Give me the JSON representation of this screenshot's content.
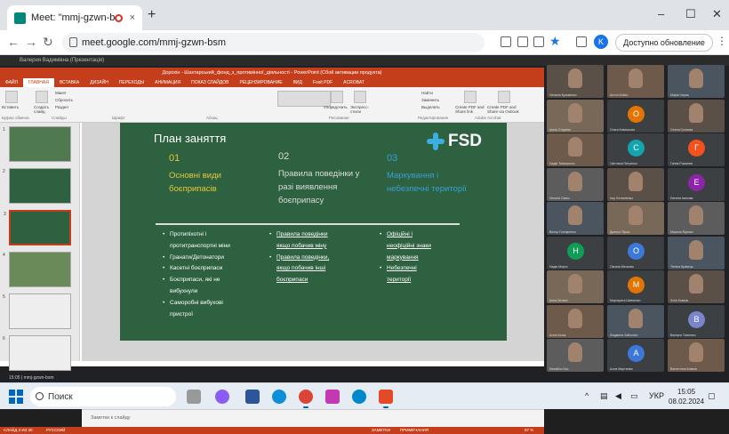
{
  "browser": {
    "tab_title": "Meet: \"mmj-gzwn-bsm\"",
    "new_tab": "+",
    "close_tab": "×",
    "url": "meet.google.com/mmj-gzwn-bsm",
    "profile_letter": "K",
    "update_label": "Доступно обновление Chrome",
    "win_min": "–",
    "win_max": "☐",
    "win_close": "✕"
  },
  "meet": {
    "presenter_label": "Валерия Вадимівна (Презентація)",
    "bottom_label": "15:05 | mmj-gzwn-bsm"
  },
  "powerpoint": {
    "window_title": "Дорохін - Шахтарський_фонд_з_протимінної_діяльності - PowerPoint (Сбой активации продукта)",
    "menu": [
      "ФАЙЛ",
      "ГЛАВНАЯ",
      "ВСТАВКА",
      "ДИЗАЙН",
      "ПЕРЕХОДЫ",
      "АНИМАЦИЯ",
      "ПОКАЗ СЛАЙДОВ",
      "РЕЦЕНЗИРОВАНИЕ",
      "ВИД",
      "Foxit PDF",
      "ACROBAT"
    ],
    "ribbon_groups": [
      "Буфер обмена",
      "Слайды",
      "Шрифт",
      "Абзац",
      "Рисование",
      "Редактирование",
      "Adobe Acrobat"
    ],
    "ribbon_labels": [
      "Вставить",
      "Создать слайд",
      "Макет",
      "Сбросить",
      "Раздел",
      "Упорядочить",
      "Экспресс-стили",
      "Найти",
      "Заменить",
      "Выделить",
      "Create PDF and Share link",
      "Create PDF and Share via Outlook"
    ],
    "notes_placeholder": "Заметки к слайду",
    "status_left": "СЛАЙД 3 ИЗ 30",
    "status_lang": "РУССКИЙ",
    "status_notes": "ЗАМЕТКИ",
    "status_comments": "ПРИМЕЧАНИЯ",
    "status_zoom": "87 %",
    "thumb_numbers": [
      "1",
      "2",
      "3",
      "4",
      "5",
      "6"
    ]
  },
  "slide": {
    "title": "План заняття",
    "logo": "FSD",
    "col1_num": "01",
    "col1_title": "Основні види боєприпасів",
    "col2_num": "02",
    "col2_title": "Правила поведінки у разі виявлення боєприпасу",
    "col3_num": "03",
    "col3_title": "Маркування і небезпечні території",
    "col1_bullets": [
      "Протипіхотні і",
      "протитранспортні міни",
      "Гранати/Детонатори",
      "Касетні боєприпаси",
      "Боєприпаси, які не",
      "вибухнули",
      "Саморобні вибухові",
      "пристрої"
    ],
    "col2_bullets": [
      "Правила поведінки",
      "якщо побачив міну",
      "Правила поведінки,",
      "якщо побачив інші",
      "боєприпаси"
    ],
    "col3_bullets": [
      "Офіційні і",
      "неофіційні знаки",
      "маркування",
      "Небезпечні",
      "території"
    ]
  },
  "participants": [
    {
      "letter": "",
      "name": "Наталія Кузьменко",
      "color": ""
    },
    {
      "letter": "",
      "name": "Антон Бойко",
      "color": ""
    },
    {
      "letter": "",
      "name": "Марія Чорна",
      "color": ""
    },
    {
      "letter": "",
      "name": "Ірина Стаднюк",
      "color": ""
    },
    {
      "letter": "O",
      "name": "Ольга Ковальова",
      "color": "#e37400"
    },
    {
      "letter": "",
      "name": "Олена Громова",
      "color": ""
    },
    {
      "letter": "",
      "name": "Надія Тимошенко",
      "color": ""
    },
    {
      "letter": "C",
      "name": "Світлана Петренко",
      "color": "#12a4af"
    },
    {
      "letter": "Г",
      "name": "Ганна Романюк",
      "color": "#f4511e"
    },
    {
      "letter": "",
      "name": "Наталя Савко",
      "color": ""
    },
    {
      "letter": "",
      "name": "Ігор Литвиненко",
      "color": ""
    },
    {
      "letter": "E",
      "name": "Євгенія Іванова",
      "color": "#8e24aa"
    },
    {
      "letter": "",
      "name": "Віктор Гончаренко",
      "color": ""
    },
    {
      "letter": "",
      "name": "Дмитро Ярош",
      "color": ""
    },
    {
      "letter": "",
      "name": "Марина Яценко",
      "color": ""
    },
    {
      "letter": "H",
      "name": "Надія Мороз",
      "color": "#0f9d58"
    },
    {
      "letter": "O",
      "name": "Оксана Мельник",
      "color": "#3c78d8"
    },
    {
      "letter": "",
      "name": "Тетяна Кравець",
      "color": ""
    },
    {
      "letter": "",
      "name": "Анна Литвин",
      "color": ""
    },
    {
      "letter": "M",
      "name": "Маргарита Шевченко",
      "color": "#e37400"
    },
    {
      "letter": "",
      "name": "Лілія Коваль",
      "color": ""
    },
    {
      "letter": "",
      "name": "Алла Козак",
      "color": ""
    },
    {
      "letter": "",
      "name": "Людмила Зайченко",
      "color": ""
    },
    {
      "letter": "B",
      "name": "Валерія Ткаченко",
      "color": "#7986cb"
    },
    {
      "letter": "",
      "name": "Михайло Бас",
      "color": ""
    },
    {
      "letter": "A",
      "name": "Алла Мартинюк",
      "color": "#3c78d8"
    },
    {
      "letter": "",
      "name": "Валентина Коваль",
      "color": ""
    }
  ],
  "taskbar": {
    "search_label": "Поиск",
    "tray_lang": "УКР",
    "time": "15:05",
    "date": "08.02.2024"
  }
}
